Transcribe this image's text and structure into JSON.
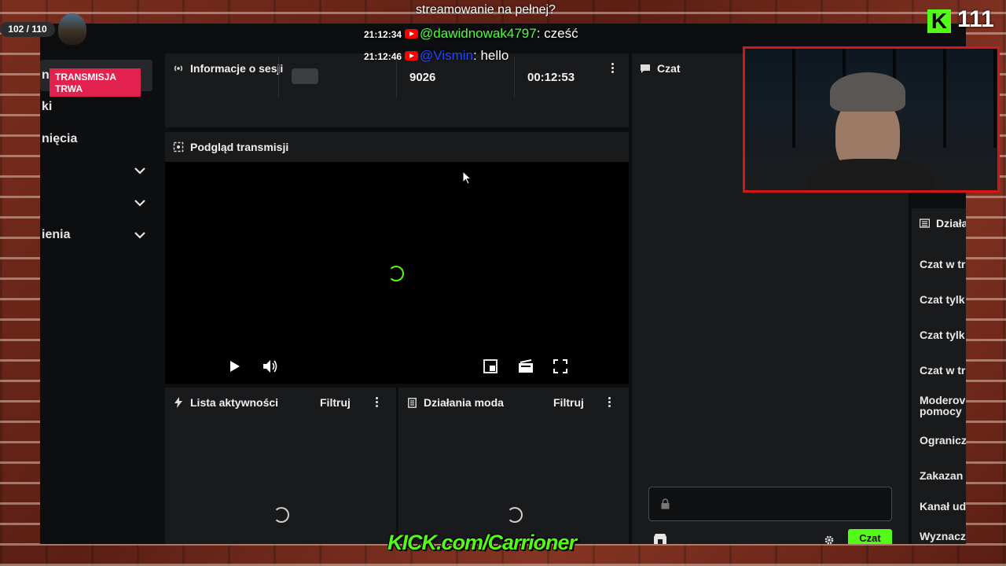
{
  "overlay": {
    "top_message": "streamowanie na pełnej?",
    "counter": "102 / 110",
    "kick_count": "111",
    "kick_letter": "K",
    "bottom_banner": "KICK.com/Carrioner",
    "chat": [
      {
        "time": "21:12:34",
        "user": "@dawidnowak4797",
        "user_color": "#4cff3a",
        "message": ": cześć"
      },
      {
        "time": "21:12:46",
        "user": "@Vismin",
        "user_color": "#2346ff",
        "message": ": hello"
      }
    ]
  },
  "nav": {
    "items": [
      {
        "label": "nisja",
        "active": true
      },
      {
        "label": "ki"
      },
      {
        "label": "nięcia"
      },
      {
        "label": ""
      },
      {
        "label": ""
      },
      {
        "label": "ienia"
      }
    ]
  },
  "session": {
    "title": "Informacje o sesji",
    "status": "TRANSMISJA TRWA",
    "viewers": "9026",
    "duration": "00:12:53"
  },
  "preview": {
    "title": "Podgląd transmisji"
  },
  "activity": {
    "title": "Lista aktywności",
    "filter": "Filtruj"
  },
  "modactions": {
    "title": "Działania moda",
    "filter": "Filtruj"
  },
  "chat_panel": {
    "title": "Czat",
    "send_label": "Czat"
  },
  "right_panel": {
    "title": "Działa",
    "items": [
      "Czat w tr",
      "Czat tylk",
      "Czat tylk",
      "Czat w tr",
      "Moderov pomocy",
      "Ogranicz",
      "Zakazan",
      "Kanał ud",
      "Wyznacz"
    ]
  },
  "colors": {
    "accent_green": "#53fc18",
    "live_red": "#e3214f",
    "frame_red": "#d41616"
  }
}
